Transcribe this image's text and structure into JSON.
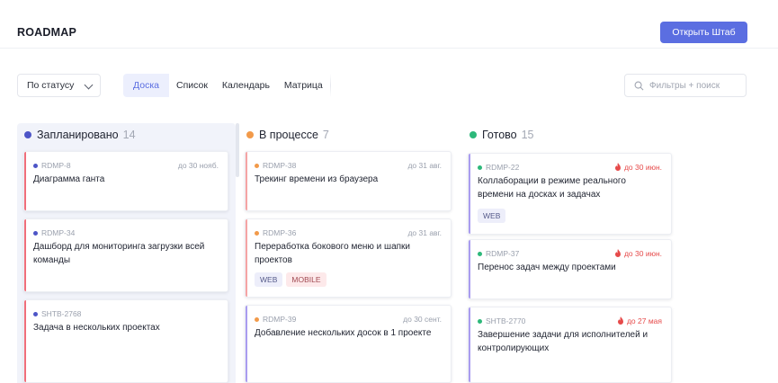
{
  "header": {
    "title": "ROADMAP",
    "open_button": "Открыть Штаб"
  },
  "toolbar": {
    "group_by": "По статусу",
    "views": [
      "Доска",
      "Список",
      "Календарь",
      "Матрица"
    ],
    "active_view": "Доска",
    "search_placeholder": "Фильтры + поиск"
  },
  "colors": {
    "accent": "#5b6ee1",
    "planned": "#4d55c7",
    "in_progress": "#f29a4a",
    "done": "#2db87a",
    "overdue": "#e64a4a",
    "card_bar_planned": "#f06e7a",
    "card_bar_progress": "#f5a4a4",
    "card_bar_done": "#a99cef"
  },
  "columns": [
    {
      "title": "Запланировано",
      "count": "14",
      "status": "planned",
      "cards": [
        {
          "id": "RDMP-8",
          "due": "до 30 нояб.",
          "title": "Диаграмма ганта",
          "tags": []
        },
        {
          "id": "RDMP-34",
          "due": "",
          "title": "Дашборд для мониторинга загрузки всей команды",
          "tags": []
        },
        {
          "id": "SHTB-2768",
          "due": "",
          "title": "Задача в нескольких проектах",
          "tags": []
        }
      ]
    },
    {
      "title": "В процессе",
      "count": "7",
      "status": "in_progress",
      "cards": [
        {
          "id": "RDMP-38",
          "due": "до 31 авг.",
          "title": "Трекинг времени из браузера",
          "tags": []
        },
        {
          "id": "RDMP-36",
          "due": "до 31 авг.",
          "title": "Переработка бокового меню и шапки проектов",
          "tags": [
            "WEB",
            "MOBILE"
          ]
        },
        {
          "id": "RDMP-39",
          "due": "до 30 сент.",
          "title": "Добавление нескольких досок в 1 проекте",
          "tags": []
        }
      ]
    },
    {
      "title": "Готово",
      "count": "15",
      "status": "done",
      "cards": [
        {
          "id": "RDMP-22",
          "due": "до 30 июн.",
          "overdue": true,
          "title": "Коллаборации в режиме реального времени на досках и задачах",
          "tags": [
            "WEB"
          ]
        },
        {
          "id": "RDMP-37",
          "due": "до 30 июн.",
          "overdue": true,
          "title": "Перенос задач между проектами",
          "tags": []
        },
        {
          "id": "SHTB-2770",
          "due": "до 27 мая",
          "overdue": true,
          "title": "Завершение задачи для исполнителей и контролирующих",
          "tags": []
        }
      ]
    }
  ]
}
